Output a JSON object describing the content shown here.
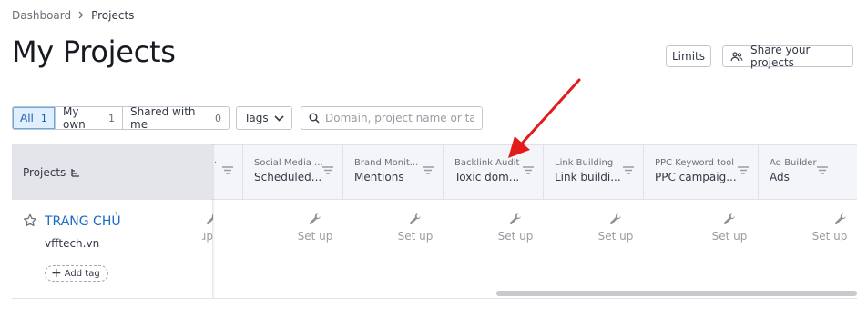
{
  "breadcrumb": {
    "root": "Dashboard",
    "current": "Projects"
  },
  "page": {
    "title": "My Projects"
  },
  "header_buttons": {
    "limits": "Limits",
    "share": "Share your projects"
  },
  "filters": {
    "segments": [
      {
        "label": "All",
        "count": "1",
        "active": true
      },
      {
        "label": "My own",
        "count": "1",
        "active": false
      },
      {
        "label": "Shared with me",
        "count": "0",
        "active": false
      }
    ],
    "tags_label": "Tags",
    "search_placeholder": "Domain, project name or tag"
  },
  "table": {
    "projects_header": "Projects",
    "partial_column": {
      "tool": "·",
      "setup_label": "t up"
    },
    "columns": [
      {
        "tool": "Social Media ...",
        "sub": "Scheduled...",
        "setup_label": "Set up"
      },
      {
        "tool": "Brand Monit...",
        "sub": "Mentions",
        "setup_label": "Set up"
      },
      {
        "tool": "Backlink Audit",
        "sub": "Toxic dom...",
        "setup_label": "Set up"
      },
      {
        "tool": "Link Building",
        "sub": "Link buildi...",
        "setup_label": "Set up"
      },
      {
        "tool": "PPC Keyword tool",
        "sub": "PPC campaig...",
        "setup_label": "Set up"
      },
      {
        "tool": "Ad Builder",
        "sub": "Ads",
        "setup_label": "Set up"
      }
    ],
    "row": {
      "name": "TRANG CHỦ",
      "domain": "vfftech.vn",
      "add_tag": "Add tag"
    }
  },
  "colors": {
    "accent": "#1a6bc2",
    "annotation_arrow": "#e21b1b",
    "active_filter_bg": "#e0efff"
  },
  "icons": [
    "chevron-right-icon",
    "people-icon",
    "chevron-down-icon",
    "search-icon",
    "sort-icon",
    "filter-icon",
    "star-icon",
    "wrench-icon",
    "plus-icon",
    "annotation-arrow"
  ]
}
